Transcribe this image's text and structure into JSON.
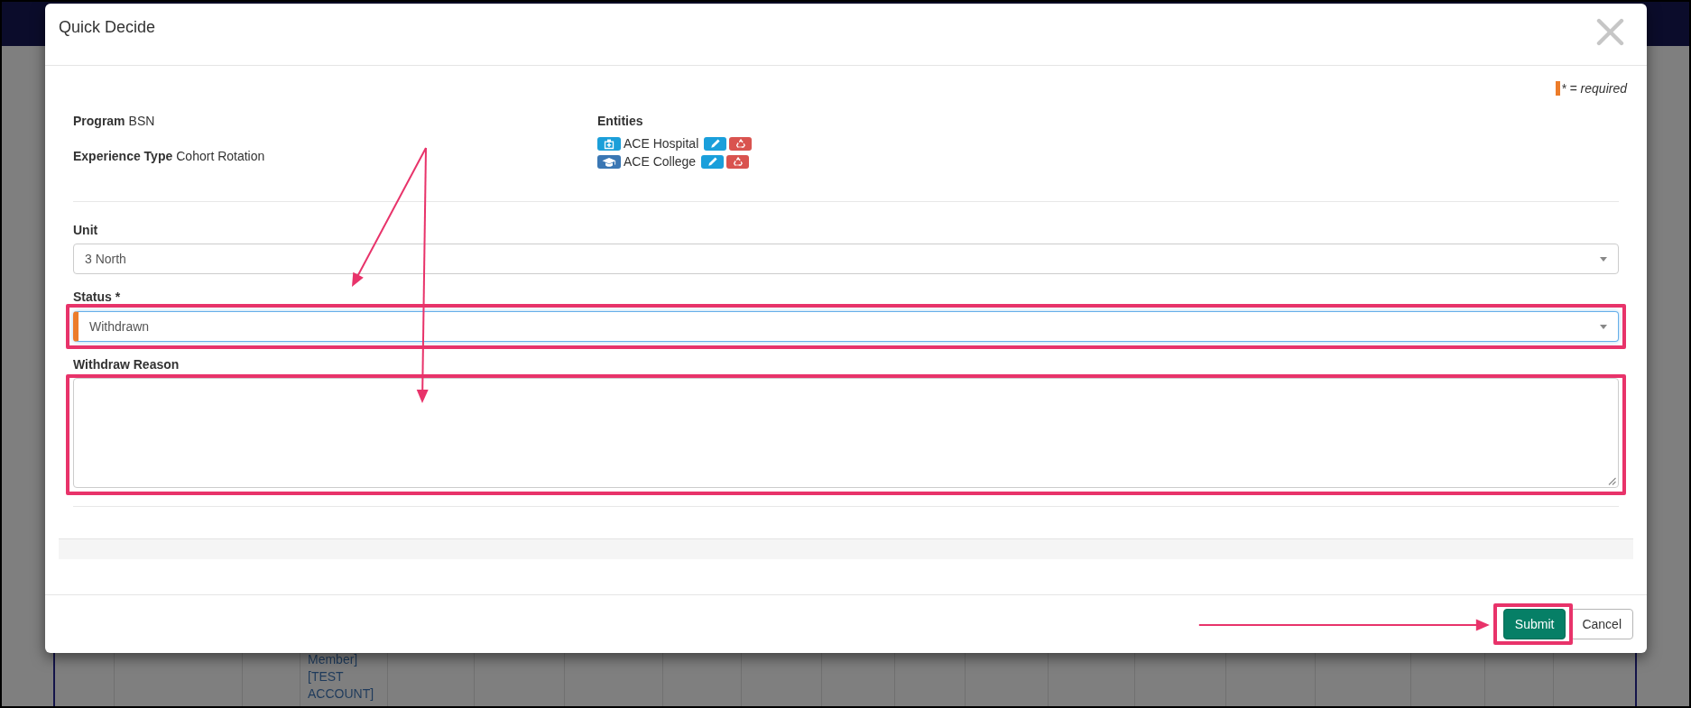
{
  "background": {
    "table_entry": "Member] [TEST ACCOUNT]"
  },
  "dialog": {
    "title": "Quick Decide",
    "legend": "* = required",
    "details": [
      {
        "label": "Program",
        "value": "BSN"
      },
      {
        "label": "Experience Type",
        "value": "Cohort Rotation"
      }
    ],
    "entities": {
      "heading": "Entities",
      "items": [
        {
          "name": "ACE Hospital",
          "kind": "hospital"
        },
        {
          "name": "ACE College",
          "kind": "school"
        }
      ]
    },
    "form": {
      "fields": [
        {
          "label": "Unit",
          "kind": "select",
          "value": "3 North",
          "required": false,
          "focused": false,
          "highlighted": false
        },
        {
          "label": "Status *",
          "kind": "select",
          "value": "Withdrawn",
          "required": true,
          "focused": true,
          "highlighted": true
        },
        {
          "label": "Withdraw Reason",
          "kind": "textarea",
          "required": false,
          "focused": false,
          "highlighted": true
        }
      ]
    },
    "buttons": [
      {
        "label": "Submit",
        "kind": "primary",
        "highlighted": true
      },
      {
        "label": "Cancel",
        "kind": "default",
        "highlighted": false
      }
    ]
  }
}
